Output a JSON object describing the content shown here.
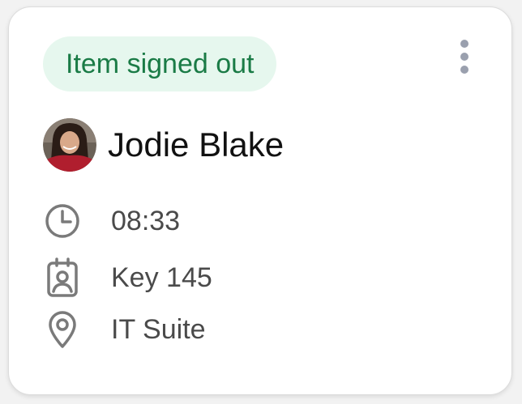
{
  "card": {
    "status_badge": "Item signed out",
    "user": {
      "name": "Jodie Blake",
      "avatar_icon": "user-avatar-photo"
    },
    "details": {
      "time": "08:33",
      "key": "Key 145",
      "location": "IT Suite"
    },
    "icons": {
      "menu": "more-vertical-icon",
      "time": "clock-icon",
      "key": "badge-icon",
      "location": "location-pin-icon"
    },
    "colors": {
      "badge_bg": "#e6f7ee",
      "badge_text": "#1a7b46",
      "icon_gray": "#7a7a7a",
      "menu_dots": "#9aa0ae"
    }
  }
}
